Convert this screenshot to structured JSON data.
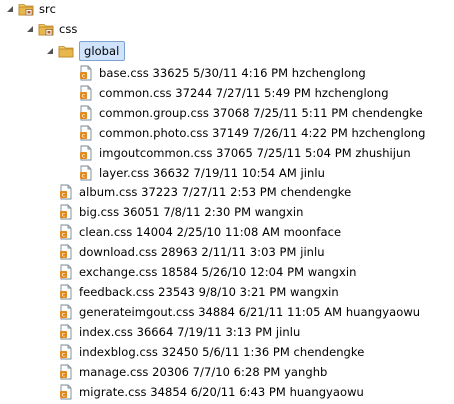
{
  "tree": {
    "folders": {
      "src": "src",
      "css": "css",
      "global": "global"
    },
    "global_files": [
      {
        "label": "base.css  33625  5/30/11 4:16 PM  hzchenglong"
      },
      {
        "label": "common.css  37244  7/27/11 5:49 PM  hzchenglong"
      },
      {
        "label": "common.group.css  37068  7/25/11 5:11 PM  chendengke"
      },
      {
        "label": "common.photo.css  37149  7/26/11 4:22 PM  hzchenglong"
      },
      {
        "label": "imgoutcommon.css  37065  7/25/11 5:04 PM  zhushijun"
      },
      {
        "label": "layer.css  36632  7/19/11 10:54 AM  jinlu"
      }
    ],
    "css_files": [
      {
        "label": "album.css  37223  7/27/11 2:53 PM  chendengke"
      },
      {
        "label": "big.css  36051  7/8/11 2:30 PM  wangxin"
      },
      {
        "label": "clean.css  14004  2/25/10 11:08 AM  moonface"
      },
      {
        "label": "download.css  28963  2/11/11 3:03 PM  jinlu"
      },
      {
        "label": "exchange.css  18584  5/26/10 12:04 PM  wangxin"
      },
      {
        "label": "feedback.css  23543  9/8/10 3:21 PM  wangxin"
      },
      {
        "label": "generateimgout.css  34884  6/21/11 11:05 AM  huangyaowu"
      },
      {
        "label": "index.css  36664  7/19/11 3:13 PM  jinlu"
      },
      {
        "label": "indexblog.css  32450  5/6/11 1:36 PM  chendengke"
      },
      {
        "label": "manage.css  20306  7/7/10 6:28 PM  yanghb"
      },
      {
        "label": "migrate.css  34854  6/20/11 6:43 PM  huangyaowu"
      }
    ]
  },
  "colors": {
    "selection_bg": "#cfe3fb",
    "selection_border": "#7da2ce",
    "folder": "#e8b64a",
    "file_badge": "#e28a1e"
  }
}
